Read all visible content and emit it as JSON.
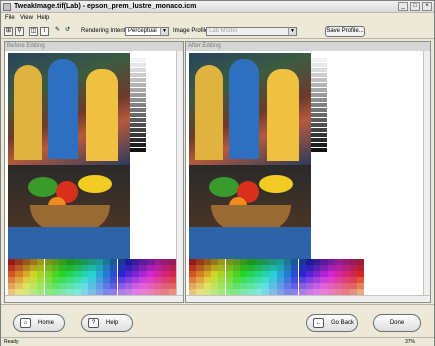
{
  "window": {
    "title": "TweakImage.tif(Lab) - epson_prem_lustre_monaco.icm",
    "min": "_",
    "max": "□",
    "close": "×"
  },
  "menu": [
    "File",
    "View",
    "Help"
  ],
  "toolbar": {
    "rendering_intent_label": "Rendering Intent",
    "rendering_intent_value": "Perceptual",
    "image_profile_label": "Image Profile:",
    "image_profile_value": "Lab Model",
    "save_profile_label": "Save Profile..."
  },
  "panels": {
    "before_title": "Before Editing",
    "after_title": "After Editing"
  },
  "buttons": {
    "home": "Home",
    "help": "Help",
    "go_back": "Go Back",
    "done": "Done"
  },
  "status": {
    "left": "Ready",
    "zoom": "37%"
  },
  "colors": {
    "panel_header": "#d6d6d6",
    "accent": "#2f63a8"
  }
}
